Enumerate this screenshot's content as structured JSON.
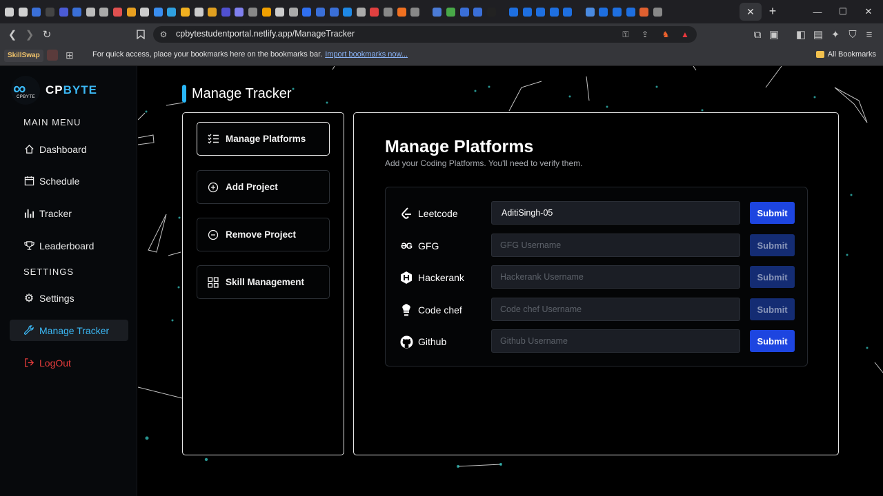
{
  "browser": {
    "url": "cpbytestudentportal.netlify.app/ManageTracker",
    "tab_favicon_colors": [
      "#d0d0d0",
      "#d0d0d0",
      "#3a6fd8",
      "#444",
      "#4b5bd6",
      "#3a6fd8",
      "#bbb",
      "#aaa",
      "#e05050",
      "#e8a020",
      "#ccc",
      "#3a8ef0",
      "#2fa0e0",
      "#f0b020",
      "#ccc",
      "#e0a020",
      "#5050d0",
      "#8080f0",
      "#888",
      "#f0a000",
      "#ccc",
      "#aaa",
      "#2f6ff0",
      "#3a6fd8",
      "#3a6fd8",
      "#1e88e5",
      "#aaa",
      "#e04040",
      "#888",
      "#f07020",
      "#888",
      "#4b7bd6",
      "#48a848",
      "#3a6fd8",
      "#3a6fd8",
      "#222",
      "#1e6fe0",
      "#1e6fe0",
      "#1e6fe0",
      "#1e6fe0",
      "#1e6fe0",
      "#4a8ae0",
      "#1e6fe0",
      "#1e6fe0",
      "#1e6fe0",
      "#e06030",
      "#888"
    ],
    "bookmarks_bar": {
      "first_bookmark": "SkillSwap",
      "message": "For quick access, place your bookmarks here on the bookmarks bar.",
      "import_link": "Import bookmarks now...",
      "all_bookmarks": "All Bookmarks"
    }
  },
  "sidebar": {
    "brand": "CP",
    "brand_accent": "BYTE",
    "logo_subtext": "CPBYTE",
    "main_menu_title": "MAIN MENU",
    "settings_title": "SETTINGS",
    "items": [
      {
        "label": "Dashboard",
        "icon": "home-icon"
      },
      {
        "label": "Schedule",
        "icon": "calendar-icon"
      },
      {
        "label": "Tracker",
        "icon": "bar-chart-icon"
      },
      {
        "label": "Leaderboard",
        "icon": "trophy-icon"
      }
    ],
    "settings_items": [
      {
        "label": "Settings",
        "icon": "gear-icon"
      },
      {
        "label": "Manage Tracker",
        "icon": "wrench-icon",
        "active": true
      },
      {
        "label": "LogOut",
        "icon": "logout-icon"
      }
    ]
  },
  "page": {
    "title": "Manage Tracker",
    "left_menu": [
      {
        "label": "Manage Platforms",
        "icon": "checklist-icon",
        "active": true
      },
      {
        "label": "Add Project",
        "icon": "plus-circle-icon"
      },
      {
        "label": "Remove Project",
        "icon": "minus-circle-icon"
      },
      {
        "label": "Skill Management",
        "icon": "grid-icon"
      }
    ],
    "main": {
      "title": "Manage Platforms",
      "subtitle": "Add your Coding Platforms. You'll need to verify them.",
      "submit_label": "Submit",
      "platforms": [
        {
          "name": "Leetcode",
          "icon": "leetcode-icon",
          "value": "AditiSingh-05",
          "placeholder": "",
          "submit_enabled": true
        },
        {
          "name": "GFG",
          "icon": "gfg-icon",
          "value": "",
          "placeholder": "GFG Username",
          "submit_enabled": false
        },
        {
          "name": "Hackerank",
          "icon": "hackerrank-icon",
          "value": "",
          "placeholder": "Hackerank Username",
          "submit_enabled": false
        },
        {
          "name": "Code chef",
          "icon": "codechef-icon",
          "value": "",
          "placeholder": "Code chef Username",
          "submit_enabled": false
        },
        {
          "name": "Github",
          "icon": "github-icon",
          "value": "",
          "placeholder": "Github Username",
          "submit_enabled": true
        }
      ]
    }
  }
}
